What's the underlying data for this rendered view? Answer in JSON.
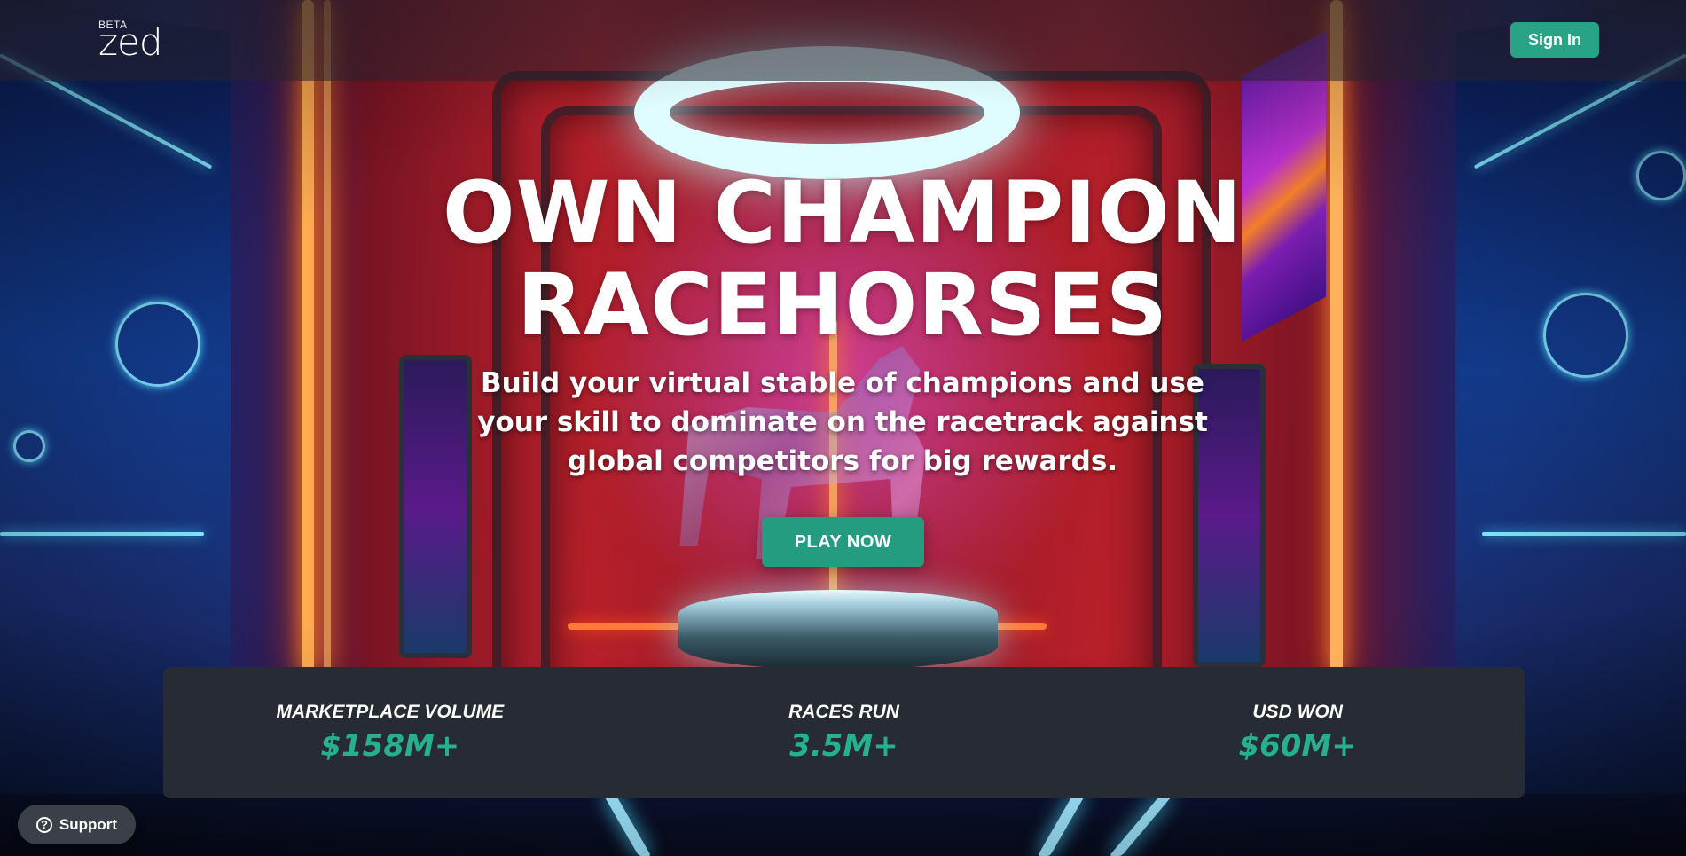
{
  "header": {
    "logo_badge": "BETA",
    "logo_text": "zed",
    "signin_label": "Sign In"
  },
  "hero": {
    "title_line1": "OWN CHAMPION",
    "title_line2": "RACEHORSES",
    "subtitle": "Build your virtual stable of champions and use your skill to dominate on the racetrack against global competitors for big rewards.",
    "cta_label": "PLAY NOW"
  },
  "stats": [
    {
      "label": "MARKETPLACE VOLUME",
      "value": "$158M+"
    },
    {
      "label": "RACES RUN",
      "value": "3.5M+"
    },
    {
      "label": "USD WON",
      "value": "$60M+"
    }
  ],
  "support": {
    "label": "Support",
    "icon": "question-circle-icon"
  },
  "colors": {
    "accent_green": "#27a386",
    "stat_value_green": "#27b08e",
    "stats_panel": "#272b33",
    "support_button": "#3b3f47"
  }
}
